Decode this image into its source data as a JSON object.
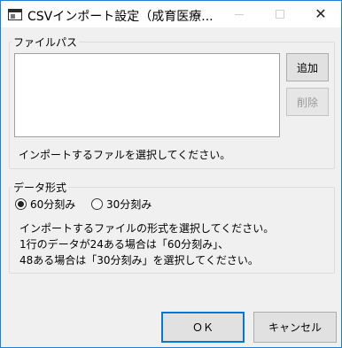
{
  "window": {
    "title": "CSVインポート設定（成育医療...",
    "close_glyph": "✕"
  },
  "file_group": {
    "legend": "ファイルパス",
    "add_button": "追加",
    "delete_button": "削除",
    "hint": "インポートするファルを選択してください。"
  },
  "format_group": {
    "legend": "データ形式",
    "options": [
      {
        "label": "60分刻み",
        "selected": true
      },
      {
        "label": "30分刻み",
        "selected": false
      }
    ],
    "description": [
      "インポートするファイルの形式を選択してください。",
      "1行のデータが24ある場合は「60分刻み」、",
      "48ある場合は「30分刻み」を選択してください。"
    ]
  },
  "footer": {
    "ok_button": "ＯＫ",
    "cancel_button": "キャンセル"
  }
}
